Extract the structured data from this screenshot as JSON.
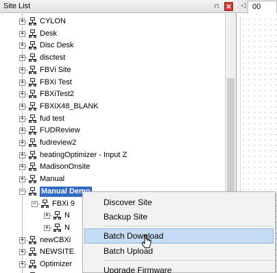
{
  "panel": {
    "title": "Site List",
    "pin_glyph": "⊓",
    "close_glyph": "✕"
  },
  "tree": {
    "items": [
      {
        "label": "CYLON",
        "expander": "+",
        "level": 0
      },
      {
        "label": "Desk",
        "expander": "+",
        "level": 0
      },
      {
        "label": "Disc Desk",
        "expander": "+",
        "level": 0
      },
      {
        "label": "disctest",
        "expander": "+",
        "level": 0
      },
      {
        "label": "FBVi Site",
        "expander": "+",
        "level": 0
      },
      {
        "label": "FBXi Test",
        "expander": "+",
        "level": 0
      },
      {
        "label": "FBXiTest2",
        "expander": "+",
        "level": 0
      },
      {
        "label": "FBXiX48_BLANK",
        "expander": "+",
        "level": 0
      },
      {
        "label": "fud test",
        "expander": "+",
        "level": 0
      },
      {
        "label": "FUDReview",
        "expander": "+",
        "level": 0
      },
      {
        "label": "fudreview2",
        "expander": "+",
        "level": 0
      },
      {
        "label": "heatingOptimizer - Input Z",
        "expander": "+",
        "level": 0
      },
      {
        "label": "MadisonOnsite",
        "expander": "+",
        "level": 0
      },
      {
        "label": "Manual",
        "expander": "+",
        "level": 0
      },
      {
        "label": "Manual Demo",
        "expander": "−",
        "level": 0,
        "selected": true
      },
      {
        "label": "FBXi 9",
        "expander": "−",
        "level": 1
      },
      {
        "label": "N",
        "expander": "+",
        "level": 2
      },
      {
        "label": "N",
        "expander": "+",
        "level": 2
      },
      {
        "label": "newCBXi",
        "expander": "+",
        "level": 0
      },
      {
        "label": "NEWSITE",
        "expander": "+",
        "level": 0
      },
      {
        "label": "Optimizer",
        "expander": "+",
        "level": 0
      },
      {
        "label": "",
        "expander": "+",
        "level": 0
      }
    ]
  },
  "right_panel": {
    "scroll_arrow": "◁",
    "tab_label": "00"
  },
  "context_menu": {
    "items": [
      {
        "label": "Discover Site"
      },
      {
        "label": "Backup Site"
      },
      {
        "label": "Batch Download",
        "highlighted": true
      },
      {
        "label": "Batch Upload"
      },
      {
        "label": "Upgrade Firmware"
      }
    ]
  },
  "colors": {
    "selection": "#316ac5",
    "menu_highlight": "#c5dcf5",
    "close_button": "#d9372e"
  }
}
